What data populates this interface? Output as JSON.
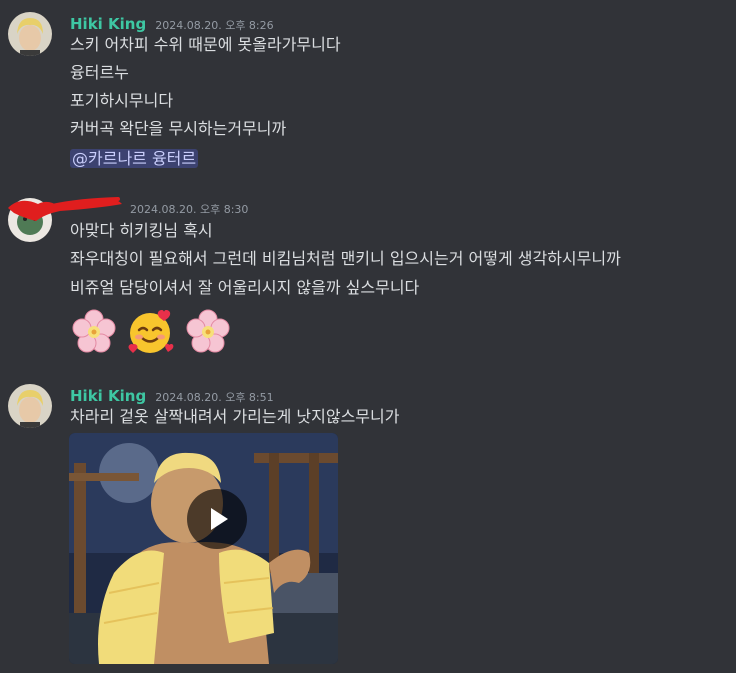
{
  "messages": [
    {
      "username": "Hiki King",
      "timestamp": "2024.08.20. 오후 8:26",
      "lines": [
        "스키 어차피 수위 때문에 못올라가무니다",
        "융터르누",
        "포기하시무니다",
        "커버곡 왁단을 무시하는거무니까"
      ],
      "mention": "@카르나르 융터르"
    },
    {
      "username": "",
      "timestamp": "2024.08.20. 오후 8:30",
      "lines": [
        "아맞다 히키킹님 혹시",
        "좌우대칭이 필요해서 그런데 비킴님처럼 맨키니 입으시는거 어떻게 생각하시무니까",
        "비쥬얼 담당이셔서 잘 어울리시지 않을까 싶스무니다"
      ],
      "emojis": [
        "cherry-blossom-icon",
        "smiling-face-with-hearts-icon",
        "cherry-blossom-icon"
      ]
    },
    {
      "username": "Hiki King",
      "timestamp": "2024.08.20. 오후 8:51",
      "lines": [
        "차라리 겉옷 살짝내려서 가리는게 낫지않스무니가"
      ]
    }
  ],
  "colors": {
    "background": "#313338",
    "username": "#3ec7a3",
    "timestamp": "#949ba4",
    "text": "#dbdee1",
    "mention_bg": "#3c4270",
    "redaction": "#e01e1e"
  }
}
